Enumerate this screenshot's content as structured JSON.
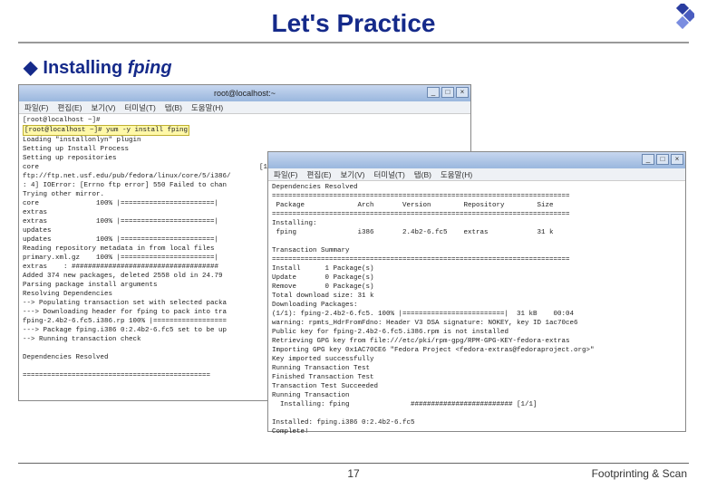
{
  "slide": {
    "title": "Let's Practice",
    "sub_prefix": "Installing ",
    "sub_italic": "fping",
    "page_number": "17",
    "footer_right": "Footprinting & Scan"
  },
  "win_back": {
    "title": "root@localhost:~",
    "menu": [
      "파일(F)",
      "편집(E)",
      "보기(V)",
      "터미널(T)",
      "탭(B)",
      "도움말(H)"
    ],
    "prompt_line": "[root@localhost ~]#",
    "cmd_line": "[root@localhost ~]# yum -y install fping",
    "body": "Loading \"installonlyn\" plugin\nSetting up Install Process\nSetting up repositories\ncore                                                      [1/3]\nftp://ftp.net.usf.edu/pub/fedora/linux/core/5/i386/\n: 4] IOError: [Errno ftp error] 550 Failed to chan\nTrying other mirror.\ncore              100% |=======================|\nextras\nextras            100% |=======================|\nupdates\nupdates           100% |=======================|\nReading repository metadata in from local files\nprimary.xml.gz    100% |=======================|\nextras    : ####################################\nAdded 374 new packages, deleted 2558 old in 24.79\nParsing package install arguments\nResolving Dependencies\n--> Populating transaction set with selected packa\n---> Downloading header for fping to pack into tra\nfping-2.4b2-6.fc5.i386.rp 100% |==================\n---> Package fping.i386 0:2.4b2-6.fc5 set to be up\n--> Running transaction check\n\nDependencies Resolved\n\n=============================================="
  },
  "win_front": {
    "title": "",
    "menu": [
      "파일(F)",
      "편집(E)",
      "보기(V)",
      "터미널(T)",
      "탭(B)",
      "도움말(H)"
    ],
    "body": "Dependencies Resolved\n=========================================================================\n Package             Arch       Version        Repository        Size\n=========================================================================\nInstalling:\n fping               i386       2.4b2-6.fc5    extras            31 k\n\nTransaction Summary\n=========================================================================\nInstall      1 Package(s)\nUpdate       0 Package(s)\nRemove       0 Package(s)\nTotal download size: 31 k\nDownloading Packages:\n(1/1): fping-2.4b2-6.fc5. 100% |=========================|  31 kB    00:04\nwarning: rpmts_HdrFromFdno: Header V3 DSA signature: NOKEY, key ID 1ac70ce6\nPublic key for fping-2.4b2-6.fc5.i386.rpm is not installed\nRetrieving GPG key from file:///etc/pki/rpm-gpg/RPM-GPG-KEY-fedora-extras\nImporting GPG key 0x1AC70CE6 \"Fedora Project <fedora-extras@fedoraproject.org>\"\nKey imported successfully\nRunning Transaction Test\nFinished Transaction Test\nTransaction Test Succeeded\nRunning Transaction\n  Installing: fping               ######################### [1/1]\n\nInstalled: fping.i386 0:2.4b2-6.fc5\nComplete!"
  },
  "win_buttons": {
    "min": "_",
    "max": "□",
    "close": "×"
  }
}
